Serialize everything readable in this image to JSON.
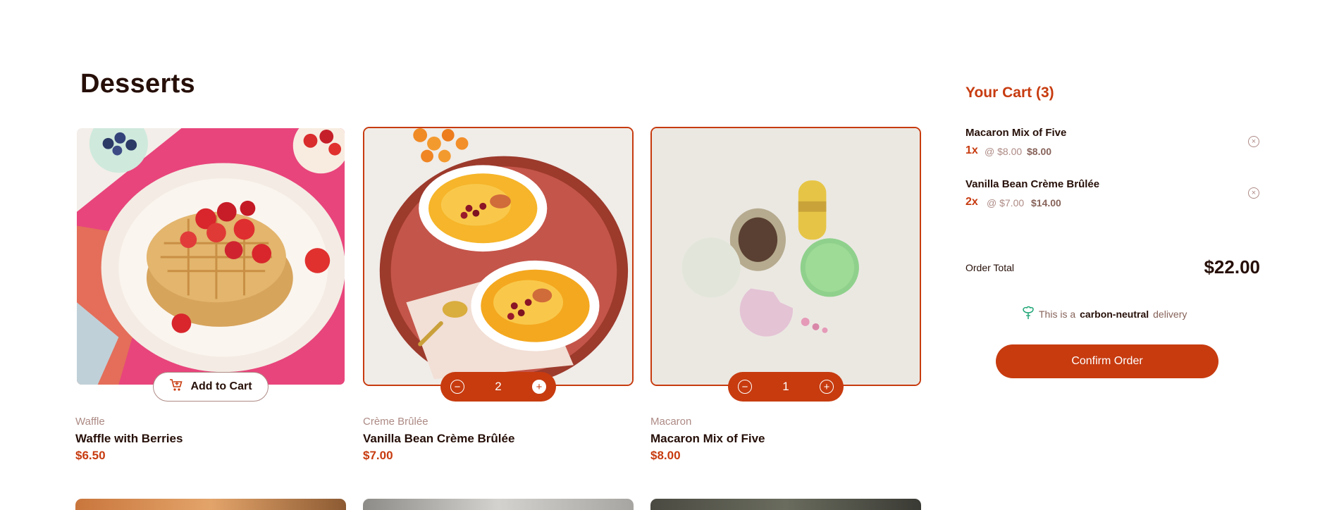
{
  "page": {
    "title": "Desserts"
  },
  "products": [
    {
      "category": "Waffle",
      "name": "Waffle with Berries",
      "price": "$6.50",
      "action_label": "Add to Cart"
    },
    {
      "category": "Crème Brûlée",
      "name": "Vanilla Bean Crème Brûlée",
      "price": "$7.00",
      "quantity": "2"
    },
    {
      "category": "Macaron",
      "name": "Macaron Mix of Five",
      "price": "$8.00",
      "quantity": "1"
    }
  ],
  "cart": {
    "title": "Your Cart (3)",
    "items": [
      {
        "name": "Macaron Mix of Five",
        "qty": "1x",
        "unit": "@ $8.00",
        "subtotal": "$8.00"
      },
      {
        "name": "Vanilla Bean Crème Brûlée",
        "qty": "2x",
        "unit": "@ $7.00",
        "subtotal": "$14.00"
      }
    ],
    "total_label": "Order Total",
    "total": "$22.00",
    "carbon_prefix": "This is a",
    "carbon_bold": "carbon-neutral",
    "carbon_suffix": "delivery",
    "confirm_label": "Confirm Order"
  },
  "colors": {
    "accent": "#c73b0f",
    "text": "#260f08",
    "muted": "#ad8a85",
    "carbon_icon": "#1ea575"
  },
  "icons": {
    "cart": "add-to-cart-icon",
    "decrement": "minus-circle-icon",
    "increment": "plus-circle-icon",
    "remove": "remove-item-icon",
    "carbon": "tree-icon"
  }
}
